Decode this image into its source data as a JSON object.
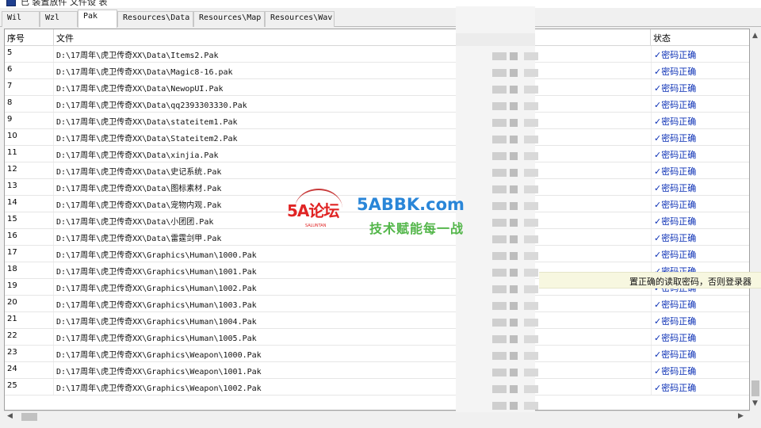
{
  "window": {
    "title": "已 装置放件 文件设 表"
  },
  "tabs": [
    {
      "label": "Wil",
      "active": false
    },
    {
      "label": "Wzl",
      "active": false
    },
    {
      "label": "Pak",
      "active": true
    },
    {
      "label": "Resources\\Data",
      "active": false
    },
    {
      "label": "Resources\\Map",
      "active": false
    },
    {
      "label": "Resources\\Wav",
      "active": false
    }
  ],
  "table": {
    "columns": {
      "index": "序号",
      "file": "文件",
      "status": "状态"
    },
    "rows": [
      {
        "no": "5",
        "path": "D:\\17周年\\虎卫传奇XX\\Data\\Items2.Pak",
        "status": "✓密码正确"
      },
      {
        "no": "6",
        "path": "D:\\17周年\\虎卫传奇XX\\Data\\Magic8-16.pak",
        "status": "✓密码正确"
      },
      {
        "no": "7",
        "path": "D:\\17周年\\虎卫传奇XX\\Data\\NewopUI.Pak",
        "status": "✓密码正确"
      },
      {
        "no": "8",
        "path": "D:\\17周年\\虎卫传奇XX\\Data\\qq2393303330.Pak",
        "status": "✓密码正确"
      },
      {
        "no": "9",
        "path": "D:\\17周年\\虎卫传奇XX\\Data\\stateitem1.Pak",
        "status": "✓密码正确"
      },
      {
        "no": "10",
        "path": "D:\\17周年\\虎卫传奇XX\\Data\\Stateitem2.Pak",
        "status": "✓密码正确"
      },
      {
        "no": "11",
        "path": "D:\\17周年\\虎卫传奇XX\\Data\\xinjia.Pak",
        "status": "✓密码正确"
      },
      {
        "no": "12",
        "path": "D:\\17周年\\虎卫传奇XX\\Data\\史记系统.Pak",
        "status": "✓密码正确"
      },
      {
        "no": "13",
        "path": "D:\\17周年\\虎卫传奇XX\\Data\\图标素材.Pak",
        "status": "✓密码正确"
      },
      {
        "no": "14",
        "path": "D:\\17周年\\虎卫传奇XX\\Data\\宠物内观.Pak",
        "status": "✓密码正确"
      },
      {
        "no": "15",
        "path": "D:\\17周年\\虎卫传奇XX\\Data\\小团团.Pak",
        "status": "✓密码正确"
      },
      {
        "no": "16",
        "path": "D:\\17周年\\虎卫传奇XX\\Data\\雷霆剑甲.Pak",
        "status": "✓密码正确"
      },
      {
        "no": "17",
        "path": "D:\\17周年\\虎卫传奇XX\\Graphics\\Human\\1000.Pak",
        "status": "✓密码正确"
      },
      {
        "no": "18",
        "path": "D:\\17周年\\虎卫传奇XX\\Graphics\\Human\\1001.Pak",
        "status": "✓密码正确"
      },
      {
        "no": "19",
        "path": "D:\\17周年\\虎卫传奇XX\\Graphics\\Human\\1002.Pak",
        "status": "✓密码正确"
      },
      {
        "no": "20",
        "path": "D:\\17周年\\虎卫传奇XX\\Graphics\\Human\\1003.Pak",
        "status": "✓密码正确"
      },
      {
        "no": "21",
        "path": "D:\\17周年\\虎卫传奇XX\\Graphics\\Human\\1004.Pak",
        "status": "✓密码正确"
      },
      {
        "no": "22",
        "path": "D:\\17周年\\虎卫传奇XX\\Graphics\\Human\\1005.Pak",
        "status": "✓密码正确"
      },
      {
        "no": "23",
        "path": "D:\\17周年\\虎卫传奇XX\\Graphics\\Weapon\\1000.Pak",
        "status": "✓密码正确"
      },
      {
        "no": "24",
        "path": "D:\\17周年\\虎卫传奇XX\\Graphics\\Weapon\\1001.Pak",
        "status": "✓密码正确"
      },
      {
        "no": "25",
        "path": "D:\\17周年\\虎卫传奇XX\\Graphics\\Weapon\\1002.Pak",
        "status": "✓密码正确"
      }
    ]
  },
  "tooltip": {
    "text": "置正确的读取密码，否则登录器"
  },
  "watermark": {
    "logo": "5A论坛",
    "logo_sub": "SALUNTAN",
    "site": "5ABBK.com",
    "slogan": "技术赋能每一战"
  },
  "scrollbars": {
    "up_icon": "▲",
    "down_icon": "▼",
    "left_icon": "◀",
    "right_icon": "▶"
  },
  "colors": {
    "status_text": "#0a2fb5",
    "watermark_red": "#e02424",
    "watermark_blue": "#2a86d8",
    "watermark_green": "#53b64a"
  }
}
